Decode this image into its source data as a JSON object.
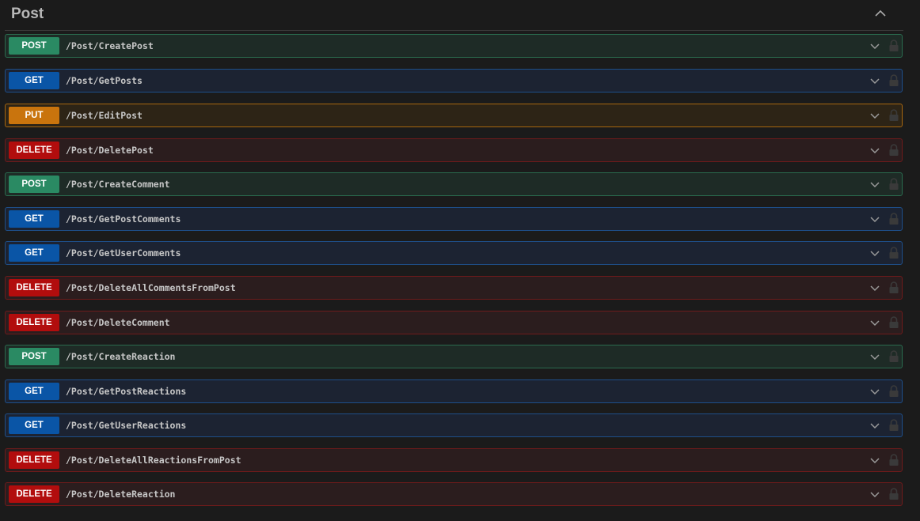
{
  "section": {
    "title": "Post",
    "toggle_icon": "chevron-up-icon"
  },
  "operations": [
    {
      "method": "POST",
      "path": "/Post/CreatePost",
      "kind": "post"
    },
    {
      "method": "GET",
      "path": "/Post/GetPosts",
      "kind": "get"
    },
    {
      "method": "PUT",
      "path": "/Post/EditPost",
      "kind": "put"
    },
    {
      "method": "DELETE",
      "path": "/Post/DeletePost",
      "kind": "delete"
    },
    {
      "method": "POST",
      "path": "/Post/CreateComment",
      "kind": "post"
    },
    {
      "method": "GET",
      "path": "/Post/GetPostComments",
      "kind": "get"
    },
    {
      "method": "GET",
      "path": "/Post/GetUserComments",
      "kind": "get"
    },
    {
      "method": "DELETE",
      "path": "/Post/DeleteAllCommentsFromPost",
      "kind": "delete"
    },
    {
      "method": "DELETE",
      "path": "/Post/DeleteComment",
      "kind": "delete"
    },
    {
      "method": "POST",
      "path": "/Post/CreateReaction",
      "kind": "post"
    },
    {
      "method": "GET",
      "path": "/Post/GetPostReactions",
      "kind": "get"
    },
    {
      "method": "GET",
      "path": "/Post/GetUserReactions",
      "kind": "get"
    },
    {
      "method": "DELETE",
      "path": "/Post/DeleteAllReactionsFromPost",
      "kind": "delete"
    },
    {
      "method": "DELETE",
      "path": "/Post/DeleteReaction",
      "kind": "delete"
    }
  ],
  "colors": {
    "post": "#2a8a63",
    "get": "#0a55a6",
    "put": "#c9740d",
    "delete": "#b20d0d",
    "background": "#1b1b1b"
  },
  "icons": {
    "expand": "chevron-down-icon",
    "auth": "lock-icon"
  }
}
